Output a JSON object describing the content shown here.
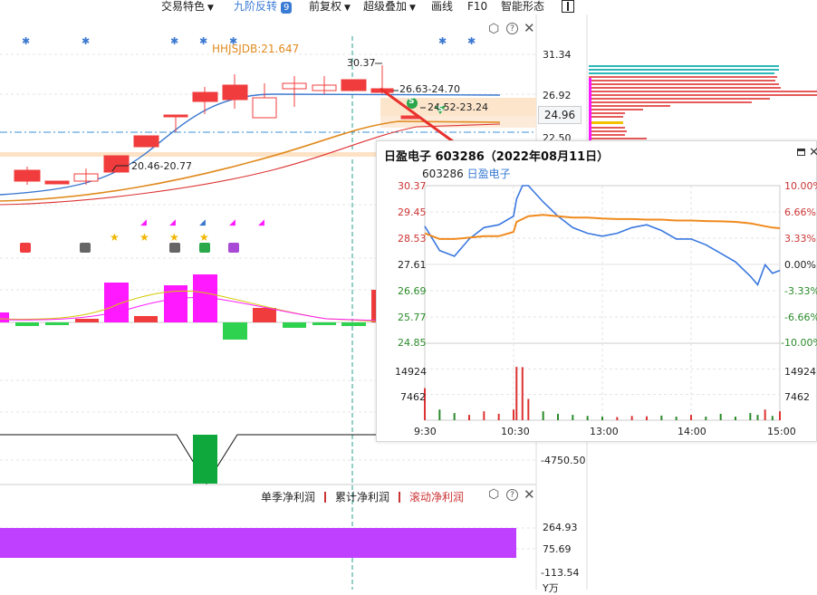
{
  "toolbar": {
    "items": [
      {
        "label": "交易特色",
        "caret": "▼"
      },
      {
        "label": "九阶反转",
        "badge": "9"
      },
      {
        "label": "前复权",
        "caret": "▼"
      },
      {
        "label": "超级叠加",
        "caret": "▼"
      },
      {
        "label": "画线"
      },
      {
        "label": "F10"
      },
      {
        "label": "智能形态"
      }
    ]
  },
  "main_chart": {
    "indicator_label": "HHJSJDB:21.647",
    "annotations": {
      "high_price": "30.37",
      "range_1": "26.63-24.70",
      "range_2": "24.52-23.24",
      "range_3": "20.46-20.77",
      "badge_s": "S"
    },
    "price_axis": [
      "31.34",
      "26.92",
      "22.50"
    ],
    "current_price": "24.96",
    "osc_axis": "-4750.50",
    "colors": {
      "up": "#f03c3c",
      "down": "#2fd24f",
      "magenta": "#ff19ff",
      "ma_blue": "#3a78d0",
      "ma_orange": "#e08a1e",
      "ma_red": "#d33"
    }
  },
  "chart_data": {
    "type": "line",
    "title": "日盈电子 603286（2022年08月11日）",
    "code": "603286",
    "name": "日盈电子",
    "x_ticks": [
      "9:30",
      "10:30",
      "13:00",
      "14:00",
      "15:00"
    ],
    "price_ticks": [
      "30.37",
      "29.45",
      "28.53",
      "27.61",
      "26.69",
      "25.77",
      "24.85"
    ],
    "pct_ticks": [
      "10.00%",
      "6.66%",
      "3.33%",
      "0.00%",
      "-3.33%",
      "-6.66%",
      "-10.00%"
    ],
    "volume_ticks": [
      "14924",
      "7462"
    ],
    "ylim": [
      24.85,
      30.37
    ],
    "prev_close": 27.61,
    "x": [
      0,
      10,
      20,
      30,
      40,
      50,
      60,
      62,
      66,
      70,
      80,
      90,
      100,
      110,
      120,
      130,
      140,
      150,
      160,
      170,
      180,
      190,
      200,
      210,
      220,
      225,
      230,
      235,
      240
    ],
    "series": [
      {
        "values": [
          28.95,
          28.1,
          27.9,
          28.5,
          28.9,
          29.0,
          29.3,
          29.9,
          30.37,
          30.37,
          29.8,
          29.3,
          28.9,
          28.7,
          28.6,
          28.7,
          28.9,
          29.0,
          28.8,
          28.5,
          28.5,
          28.3,
          28.0,
          27.7,
          27.2,
          26.9,
          27.6,
          27.3,
          27.4
        ]
      },
      {
        "values": [
          28.7,
          28.5,
          28.5,
          28.55,
          28.6,
          28.6,
          28.75,
          29.1,
          29.2,
          29.3,
          29.35,
          29.3,
          29.25,
          29.25,
          29.22,
          29.2,
          29.2,
          29.18,
          29.18,
          29.15,
          29.15,
          29.13,
          29.12,
          29.1,
          29.05,
          29.0,
          28.95,
          28.9,
          28.88
        ]
      }
    ],
    "volume": [
      9000,
      3000,
      2000,
      1500,
      2500,
      1800,
      3000,
      15000,
      14924,
      6000,
      2500,
      1800,
      1500,
      1200,
      1000,
      900,
      1200,
      1100,
      1300,
      1000,
      1500,
      1000,
      1800,
      1000,
      2000,
      1500,
      3000,
      1200,
      2500
    ]
  },
  "bottom_panel": {
    "legend": [
      "单季净利润",
      "累计净利润",
      "滚动净利润"
    ],
    "axis": [
      "264.93",
      "75.69",
      "-113.54"
    ],
    "unit": "Y万"
  }
}
